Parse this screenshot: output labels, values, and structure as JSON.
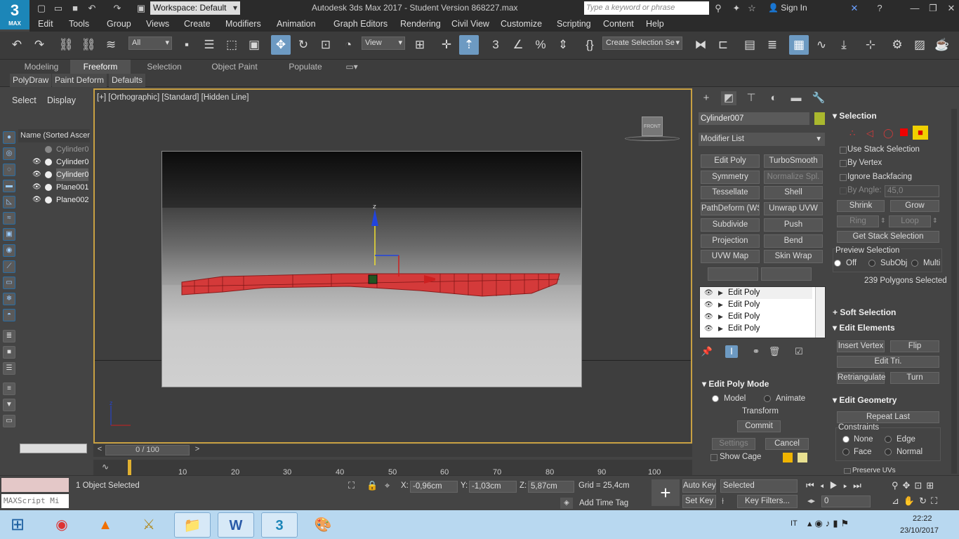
{
  "app": {
    "logo_number": "3",
    "logo_label": "MAX",
    "workspace": "Workspace: Default",
    "title": "Autodesk 3ds Max 2017 - Student Version   868227.max",
    "search_placeholder": "Type a keyword or phrase",
    "sign_in": "Sign In"
  },
  "menu": [
    "Edit",
    "Tools",
    "Group",
    "Views",
    "Create",
    "Modifiers",
    "Animation",
    "Graph Editors",
    "Rendering",
    "Civil View",
    "Customize",
    "Scripting",
    "Content",
    "Help"
  ],
  "toolbar": {
    "filter": "All",
    "view": "View",
    "selection_set": "Create Selection Se"
  },
  "ribbon": {
    "tabs": [
      "Modeling",
      "Freeform",
      "Selection",
      "Object Paint",
      "Populate"
    ],
    "active": "Freeform",
    "subtabs": [
      "PolyDraw",
      "Paint Deform",
      "Defaults"
    ]
  },
  "scene_explorer": {
    "tabs": [
      "Select",
      "Display"
    ],
    "header": "Name (Sorted Ascer",
    "items": [
      "Cylinder0",
      "Cylinder0",
      "Cylinder0",
      "Plane001",
      "Plane002"
    ]
  },
  "viewport": {
    "label": "[+] [Orthographic] [Standard] [Hidden Line]",
    "viewcube": "FRONT",
    "gizmo_axis": "z"
  },
  "timeline": {
    "frame": "0 / 100",
    "ticks": [
      "10",
      "20",
      "30",
      "40",
      "50",
      "60",
      "70",
      "80",
      "90",
      "100"
    ]
  },
  "command_panel": {
    "object_name": "Cylinder007",
    "modifier_list": "Modifier List",
    "buttons": [
      "Edit Poly",
      "TurboSmooth",
      "Symmetry",
      "Normalize Spl.",
      "Tessellate",
      "Shell",
      "PathDeform (WSM)",
      "Unwrap UVW",
      "Subdivide",
      "Push",
      "Projection",
      "Bend",
      "UVW Map",
      "Skin Wrap"
    ],
    "stack": [
      "Edit Poly",
      "Edit Poly",
      "Edit Poly",
      "Edit Poly"
    ],
    "edit_poly_mode": {
      "title": "Edit Poly Mode",
      "model": "Model",
      "animate": "Animate",
      "transform": "Transform",
      "commit": "Commit",
      "settings": "Settings",
      "cancel": "Cancel",
      "show_cage": "Show Cage"
    }
  },
  "selection_panel": {
    "title": "Selection",
    "use_stack": "Use Stack Selection",
    "by_vertex": "By Vertex",
    "ignore_backfacing": "Ignore Backfacing",
    "by_angle": "By Angle:",
    "angle_value": "45,0",
    "shrink": "Shrink",
    "grow": "Grow",
    "ring": "Ring",
    "loop": "Loop",
    "get_stack": "Get Stack Selection",
    "preview_title": "Preview Selection",
    "preview_options": [
      "Off",
      "SubObj",
      "Multi"
    ],
    "status": "239 Polygons Selected",
    "soft_selection": "Soft Selection",
    "edit_elements": "Edit Elements",
    "insert_vertex": "Insert Vertex",
    "flip": "Flip",
    "edit_tri": "Edit Tri.",
    "retriangulate": "Retriangulate",
    "turn": "Turn",
    "edit_geometry": "Edit Geometry",
    "repeat_last": "Repeat Last",
    "constraints": "Constraints",
    "constraint_options": [
      "None",
      "Edge",
      "Face",
      "Normal"
    ],
    "preserve_uvs": "Preserve UVs"
  },
  "status_bar": {
    "script_placeholder": "MAXScript Mi",
    "selected": "1 Object Selected",
    "x_label": "X:",
    "x": "-0,96cm",
    "y_label": "Y:",
    "y": "-1,03cm",
    "z_label": "Z:",
    "z": "5,87cm",
    "grid": "Grid = 25,4cm",
    "add_time_tag": "Add Time Tag",
    "auto_key": "Auto Key",
    "set_key": "Set Key",
    "selected_dd": "Selected",
    "key_filters": "Key Filters...",
    "frame_value": "0"
  },
  "taskbar": {
    "lang": "IT",
    "time": "22:22",
    "date": "23/10/2017"
  },
  "colors": {
    "accent": "#6d9ac2",
    "viewport_border": "#c8a042",
    "selection_red": "#d43a3a",
    "object_swatch": "#aab82e"
  }
}
